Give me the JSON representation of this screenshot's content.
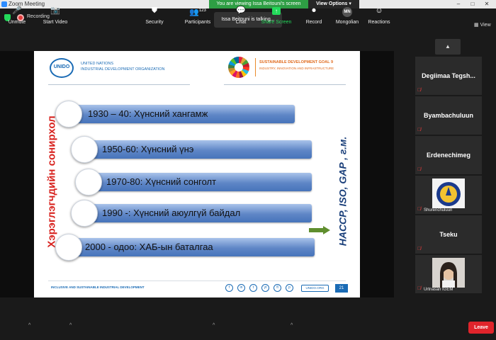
{
  "window": {
    "title": "Zoom Meeting"
  },
  "share_banner": {
    "viewing_text": "You are viewing Issa Beitouni's screen",
    "view_options": "View Options"
  },
  "topbar": {
    "recording_label": "Recording",
    "talking_text": "Issa Beitouni is talking...",
    "view_label": "View"
  },
  "slide": {
    "unido_logo": "UNIDO",
    "org_name": "UNITED NATIONS\nINDUSTRIAL DEVELOPMENT ORGANIZATION",
    "sdg_title": "SUSTAINABLE DEVELOPMENT GOAL 9",
    "sdg_subtitle": "INDUSTRY, INNOVATION AND INFRASTRUCTURE",
    "left_vertical": "Хэрэглэгчдийн сонирхол",
    "right_vertical": "HACCP, ISO, GAP , г.м.",
    "items": [
      "1930 – 40: Хүнсний хангамж",
      "1950-60: Хүнсний үнэ",
      "1970-80: Хүнсний сонголт",
      "1990 -: Хүнсний аюулгүй байдал",
      "2000 - одоо: ХАБ-ын баталгаа"
    ],
    "footer_text": "INCLUSIVE AND SUSTAINABLE INDUSTRIAL DEVELOPMENT",
    "social_icons": [
      "f",
      "in",
      "t",
      "yt",
      "fl",
      "p"
    ],
    "url": "UNIDO.ORG",
    "page_number": "21"
  },
  "participants": [
    {
      "name": "Degiimaa  Tegsh...",
      "muted": true
    },
    {
      "name": "Byambachuluun",
      "muted": true
    },
    {
      "name": "Erdenechimeg",
      "muted": true
    },
    {
      "name": "Shurenchuluun",
      "muted": true
    },
    {
      "name": "Tseku",
      "muted": true
    },
    {
      "name": "Urtnasan IGEM",
      "muted": true
    }
  ],
  "toolbar": {
    "unmute": "Unmute",
    "start_video": "Start Video",
    "security": "Security",
    "participants": "Participants",
    "participants_count": "123",
    "chat": "Chat",
    "share_screen": "Share Screen",
    "record": "Record",
    "language": "Mongolian",
    "language_badge": "MN",
    "reactions": "Reactions",
    "leave": "Leave"
  },
  "colors": {
    "share_green": "#2e9e44",
    "leave_red": "#e0242b",
    "slide_title_red": "#d8231f",
    "slide_blue": "#1a6bb5"
  }
}
